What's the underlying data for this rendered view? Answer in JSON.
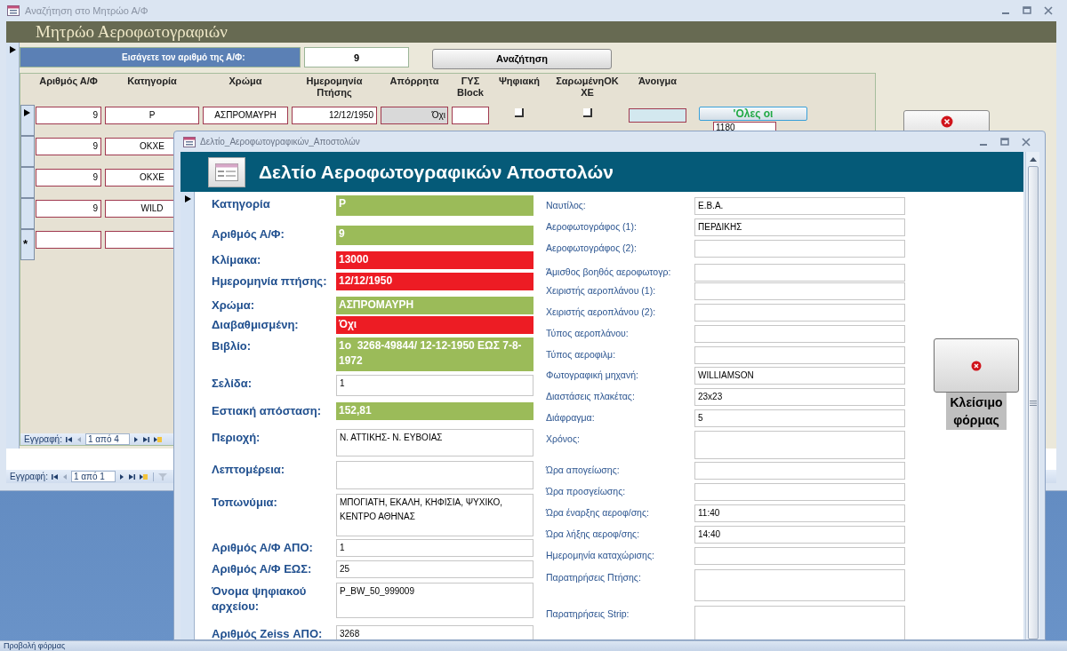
{
  "main_window": {
    "title": "Αναζήτηση στο Μητρώο Α/Φ",
    "header": "Μητρώο Αεροφωτογραφιών",
    "search": {
      "label": "Εισάγετε τον αριθμό της Α/Φ:",
      "value": "9",
      "button": "Αναζήτηση"
    },
    "datasheet": {
      "columns": [
        "Αριθμός Α/Φ",
        "Κατηγορία",
        "Χρώμα",
        "Ημερομηνία Πτήσης",
        "Απόρρητα",
        "ΓΥΣ Block",
        "Ψηφιακή",
        "ΣαρωμένηΟΚ ΧΕ",
        "Άνοιγμα"
      ],
      "rows": [
        {
          "kind": "record",
          "current": true,
          "number": "9",
          "category": "P",
          "film_type": "ΑΣΠΡΟΜΑΥΡΗ",
          "flight_date": "12/12/1950",
          "classified": "Όχι",
          "digital": false,
          "scanned_ok": false,
          "button": "'Ολες οι",
          "count": "1180"
        },
        {
          "kind": "record",
          "current": false,
          "number": "9",
          "category": "ΟΚΧΕ"
        },
        {
          "kind": "record",
          "current": false,
          "number": "9",
          "category": "ΟΚΧΕ"
        },
        {
          "kind": "record",
          "current": false,
          "number": "9",
          "category": "WILD"
        },
        {
          "kind": "new",
          "marker": "*"
        }
      ],
      "record_nav": {
        "label": "Εγγραφή:",
        "position": "1 από 4"
      }
    },
    "record_nav": {
      "label": "Εγγραφή:",
      "position": "1 από 1"
    }
  },
  "dialog": {
    "title": "Δελτίο_Αεροφωτογραφικών_Αποστολών",
    "header": "Δελτίο Αεροφωτογραφικών Αποστολών",
    "left_fields": [
      {
        "label": "Κατηγορία",
        "value": "P",
        "color": "#9bbb59"
      },
      {
        "label": "Αριθμός Α/Φ:",
        "value": "9",
        "color": "#9bbb59"
      },
      {
        "label": "Κλίμακα:",
        "value": "13000",
        "color": "#ed1c24"
      },
      {
        "label": "Ημερομηνία πτήσης:",
        "value": "12/12/1950",
        "color": "#ed1c24"
      },
      {
        "label": "Χρώμα:",
        "value": "ΑΣΠΡΟΜΑΥΡΗ",
        "color": "#9bbb59"
      },
      {
        "label": "Διαβαθμισμένη:",
        "value": "Όχι",
        "color": "#ed1c24"
      },
      {
        "label": "Βιβλίο:",
        "value": "1ο  3268-49844/ 12-12-1950 ΕΩΣ 7-8-1972",
        "color": "#9bbb59"
      },
      {
        "label": "Σελίδα:",
        "value": "1"
      },
      {
        "label": "Εστιακή απόσταση:",
        "value": "152,81",
        "color": "#9bbb59"
      },
      {
        "label": "Περιοχή:",
        "value": "Ν. ΑΤΤΙΚΗΣ- Ν. ΕΥΒΟΙΑΣ"
      },
      {
        "label": "Λεπτομέρεια:"
      },
      {
        "label": "Τοπωνύμια:",
        "value": "ΜΠΟΓΙΑΤΗ, ΕΚΑΛΗ, ΚΗΦΙΣΙΑ, ΨΥΧΙΚΟ, ΚΕΝΤΡΟ ΑΘΗΝΑΣ"
      },
      {
        "label": "Αριθμός Α/Φ ΑΠΟ:",
        "value": "1"
      },
      {
        "label": "Αριθμός Α/Φ ΕΩΣ:",
        "value": "25"
      },
      {
        "label": "Όνομα ψηφιακού αρχείου:",
        "value": "P_BW_50_999009"
      },
      {
        "label": "Αριθμός Zeiss ΑΠΟ:",
        "value": "3268"
      }
    ],
    "right_fields": [
      {
        "label": "Ναυτίλος:",
        "value": "Ε.Β.Α."
      },
      {
        "label": "Αεροφωτογράφος (1):",
        "value": "ΠΕΡΔΙΚΗΣ"
      },
      {
        "label": "Αεροφωτογράφος (2):"
      },
      {
        "label": "Άμισθος βοηθός αεροφωτογρ:"
      },
      {
        "label": "Χειριστής αεροπλάνου (1):"
      },
      {
        "label": "Χειριστής αεροπλάνου (2):"
      },
      {
        "label": "Τύπος αεροπλάνου:"
      },
      {
        "label": "Τύπος αεροφιλμ:"
      },
      {
        "label": "Φωτογραφική μηχανή:",
        "value": "WILLIAMSON"
      },
      {
        "label": "Διαστάσεις πλακέτας:",
        "value": "23x23"
      },
      {
        "label": "Διάφραγμα:",
        "value": "5"
      },
      {
        "label": "Χρόνος:"
      },
      {
        "label": "Ώρα απογείωσης:"
      },
      {
        "label": "Ώρα προσγείωσης:"
      },
      {
        "label": "Ώρα έναρξης αεροφ/σης:",
        "value": "11:40"
      },
      {
        "label": "Ώρα λήξης αεροφ/σης:",
        "value": "14:40"
      },
      {
        "label": "Ημερομηνία καταχώρισης:"
      },
      {
        "label": "Παρατηρήσεις Πτήσης:"
      },
      {
        "label": "Παρατηρήσεις Strip:"
      }
    ],
    "close_label": "Κλείσιμο φόρμας"
  },
  "status_bar": "Προβολή φόρμας"
}
